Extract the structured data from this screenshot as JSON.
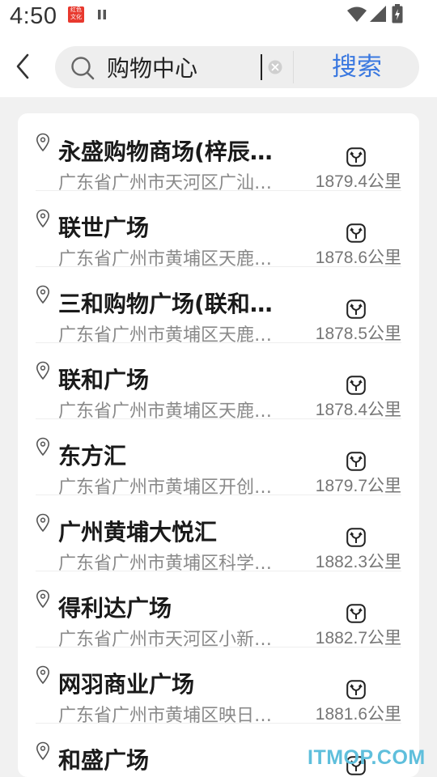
{
  "status_bar": {
    "time": "4:50",
    "app_badge_top": "红色",
    "app_badge_bottom": "文化"
  },
  "search": {
    "query": "购物中心",
    "button_label": "搜索"
  },
  "results": [
    {
      "name": "永盛购物商场(梓辰…",
      "address": "广东省广州市天河区广汕…",
      "distance": "1879.4公里"
    },
    {
      "name": "联世广场",
      "address": "广东省广州市黄埔区天鹿…",
      "distance": "1878.6公里"
    },
    {
      "name": "三和购物广场(联和…",
      "address": "广东省广州市黄埔区天鹿…",
      "distance": "1878.5公里"
    },
    {
      "name": "联和广场",
      "address": "广东省广州市黄埔区天鹿…",
      "distance": "1878.4公里"
    },
    {
      "name": "东方汇",
      "address": "广东省广州市黄埔区开创…",
      "distance": "1879.7公里"
    },
    {
      "name": "广州黄埔大悦汇",
      "address": "广东省广州市黄埔区科学…",
      "distance": "1882.3公里"
    },
    {
      "name": "得利达广场",
      "address": "广东省广州市天河区小新…",
      "distance": "1882.7公里"
    },
    {
      "name": "网羽商业广场",
      "address": "广东省广州市黄埔区映日…",
      "distance": "1881.6公里"
    },
    {
      "name": "和盛广场",
      "address": "",
      "distance": ""
    }
  ],
  "watermark": "ITMOP.COM",
  "colors": {
    "accent": "#3a78e0",
    "background": "#f1f1f1",
    "card": "#ffffff"
  }
}
